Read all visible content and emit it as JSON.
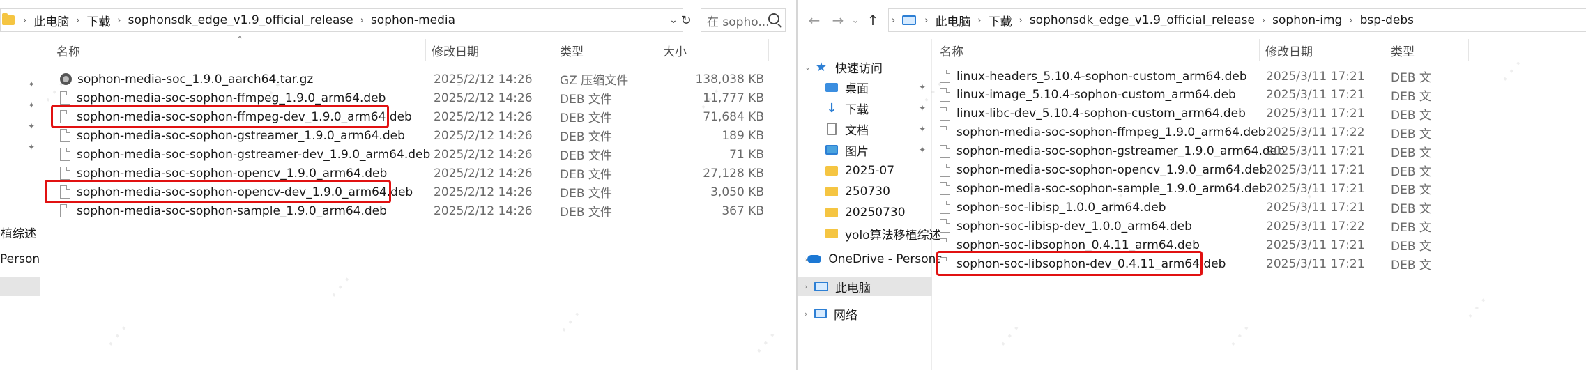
{
  "left": {
    "path": [
      "此电脑",
      "下载",
      "sophonsdk_edge_v1.9_official_release",
      "sophon-media"
    ],
    "search_placeholder": "在 sopho...",
    "nav": [
      {
        "label": "移植综述",
        "selected": false
      },
      {
        "label": "Persona",
        "selected": false
      },
      {
        "label": "",
        "selected": true
      }
    ],
    "columns": {
      "name": "名称",
      "date": "修改日期",
      "type": "类型",
      "size": "大小"
    },
    "files": [
      {
        "name": "sophon-media-soc_1.9.0_aarch64.tar.gz",
        "date": "2025/2/12 14:26",
        "type": "GZ 压缩文件",
        "size": "138,038 KB",
        "icon": "archive-icon",
        "highlighted": false
      },
      {
        "name": "sophon-media-soc-sophon-ffmpeg_1.9.0_arm64.deb",
        "date": "2025/2/12 14:26",
        "type": "DEB 文件",
        "size": "11,777 KB",
        "icon": "file-icon",
        "highlighted": false
      },
      {
        "name": "sophon-media-soc-sophon-ffmpeg-dev_1.9.0_arm64.deb",
        "date": "2025/2/12 14:26",
        "type": "DEB 文件",
        "size": "71,684 KB",
        "icon": "file-icon",
        "highlighted": true
      },
      {
        "name": "sophon-media-soc-sophon-gstreamer_1.9.0_arm64.deb",
        "date": "2025/2/12 14:26",
        "type": "DEB 文件",
        "size": "189 KB",
        "icon": "file-icon",
        "highlighted": false
      },
      {
        "name": "sophon-media-soc-sophon-gstreamer-dev_1.9.0_arm64.deb",
        "date": "2025/2/12 14:26",
        "type": "DEB 文件",
        "size": "71 KB",
        "icon": "file-icon",
        "highlighted": false
      },
      {
        "name": "sophon-media-soc-sophon-opencv_1.9.0_arm64.deb",
        "date": "2025/2/12 14:26",
        "type": "DEB 文件",
        "size": "27,128 KB",
        "icon": "file-icon",
        "highlighted": false
      },
      {
        "name": "sophon-media-soc-sophon-opencv-dev_1.9.0_arm64.deb",
        "date": "2025/2/12 14:26",
        "type": "DEB 文件",
        "size": "3,050 KB",
        "icon": "file-icon",
        "highlighted": true
      },
      {
        "name": "sophon-media-soc-sophon-sample_1.9.0_arm64.deb",
        "date": "2025/2/12 14:26",
        "type": "DEB 文件",
        "size": "367 KB",
        "icon": "file-icon",
        "highlighted": false
      }
    ]
  },
  "right": {
    "path": [
      "此电脑",
      "下载",
      "sophonsdk_edge_v1.9_official_release",
      "sophon-img",
      "bsp-debs"
    ],
    "nav": [
      {
        "label": "快速访问",
        "icon": "star-icon",
        "pinned": false,
        "selected": false
      },
      {
        "label": "桌面",
        "icon": "desktop-icon",
        "pinned": true,
        "selected": false
      },
      {
        "label": "下载",
        "icon": "download-icon",
        "pinned": true,
        "selected": false
      },
      {
        "label": "文档",
        "icon": "document-icon",
        "pinned": true,
        "selected": false
      },
      {
        "label": "图片",
        "icon": "pictures-icon",
        "pinned": true,
        "selected": false
      },
      {
        "label": "2025-07",
        "icon": "folder-icon",
        "pinned": false,
        "selected": false
      },
      {
        "label": "250730",
        "icon": "folder-icon",
        "pinned": false,
        "selected": false
      },
      {
        "label": "20250730",
        "icon": "folder-icon",
        "pinned": false,
        "selected": false
      },
      {
        "label": "yolo算法移植综述",
        "icon": "folder-icon",
        "pinned": false,
        "selected": false
      },
      {
        "label": "OneDrive - Persona",
        "icon": "cloud-icon",
        "pinned": false,
        "selected": false
      },
      {
        "label": "此电脑",
        "icon": "computer-icon",
        "pinned": false,
        "selected": true
      },
      {
        "label": "网络",
        "icon": "network-icon",
        "pinned": false,
        "selected": false
      }
    ],
    "columns": {
      "name": "名称",
      "date": "修改日期",
      "type": "类型"
    },
    "files": [
      {
        "name": "linux-headers_5.10.4-sophon-custom_arm64.deb",
        "date": "2025/3/11 17:21",
        "type": "DEB 文",
        "highlighted": false
      },
      {
        "name": "linux-image_5.10.4-sophon-custom_arm64.deb",
        "date": "2025/3/11 17:21",
        "type": "DEB 文",
        "highlighted": false
      },
      {
        "name": "linux-libc-dev_5.10.4-sophon-custom_arm64.deb",
        "date": "2025/3/11 17:21",
        "type": "DEB 文",
        "highlighted": false
      },
      {
        "name": "sophon-media-soc-sophon-ffmpeg_1.9.0_arm64.deb",
        "date": "2025/3/11 17:22",
        "type": "DEB 文",
        "highlighted": false
      },
      {
        "name": "sophon-media-soc-sophon-gstreamer_1.9.0_arm64.deb",
        "date": "2025/3/11 17:21",
        "type": "DEB 文",
        "highlighted": false
      },
      {
        "name": "sophon-media-soc-sophon-opencv_1.9.0_arm64.deb",
        "date": "2025/3/11 17:21",
        "type": "DEB 文",
        "highlighted": false
      },
      {
        "name": "sophon-media-soc-sophon-sample_1.9.0_arm64.deb",
        "date": "2025/3/11 17:21",
        "type": "DEB 文",
        "highlighted": false
      },
      {
        "name": "sophon-soc-libisp_1.0.0_arm64.deb",
        "date": "2025/3/11 17:21",
        "type": "DEB 文",
        "highlighted": false
      },
      {
        "name": "sophon-soc-libisp-dev_1.0.0_arm64.deb",
        "date": "2025/3/11 17:22",
        "type": "DEB 文",
        "highlighted": false
      },
      {
        "name": "sophon-soc-libsophon_0.4.11_arm64.deb",
        "date": "2025/3/11 17:21",
        "type": "DEB 文",
        "highlighted": false
      },
      {
        "name": "sophon-soc-libsophon-dev_0.4.11_arm64.deb",
        "date": "2025/3/11 17:21",
        "type": "DEB 文",
        "highlighted": true
      }
    ]
  },
  "colors": {
    "highlight": "#e11111",
    "selected_nav": "#e5e5e5",
    "accent": "#2d7fd4"
  }
}
